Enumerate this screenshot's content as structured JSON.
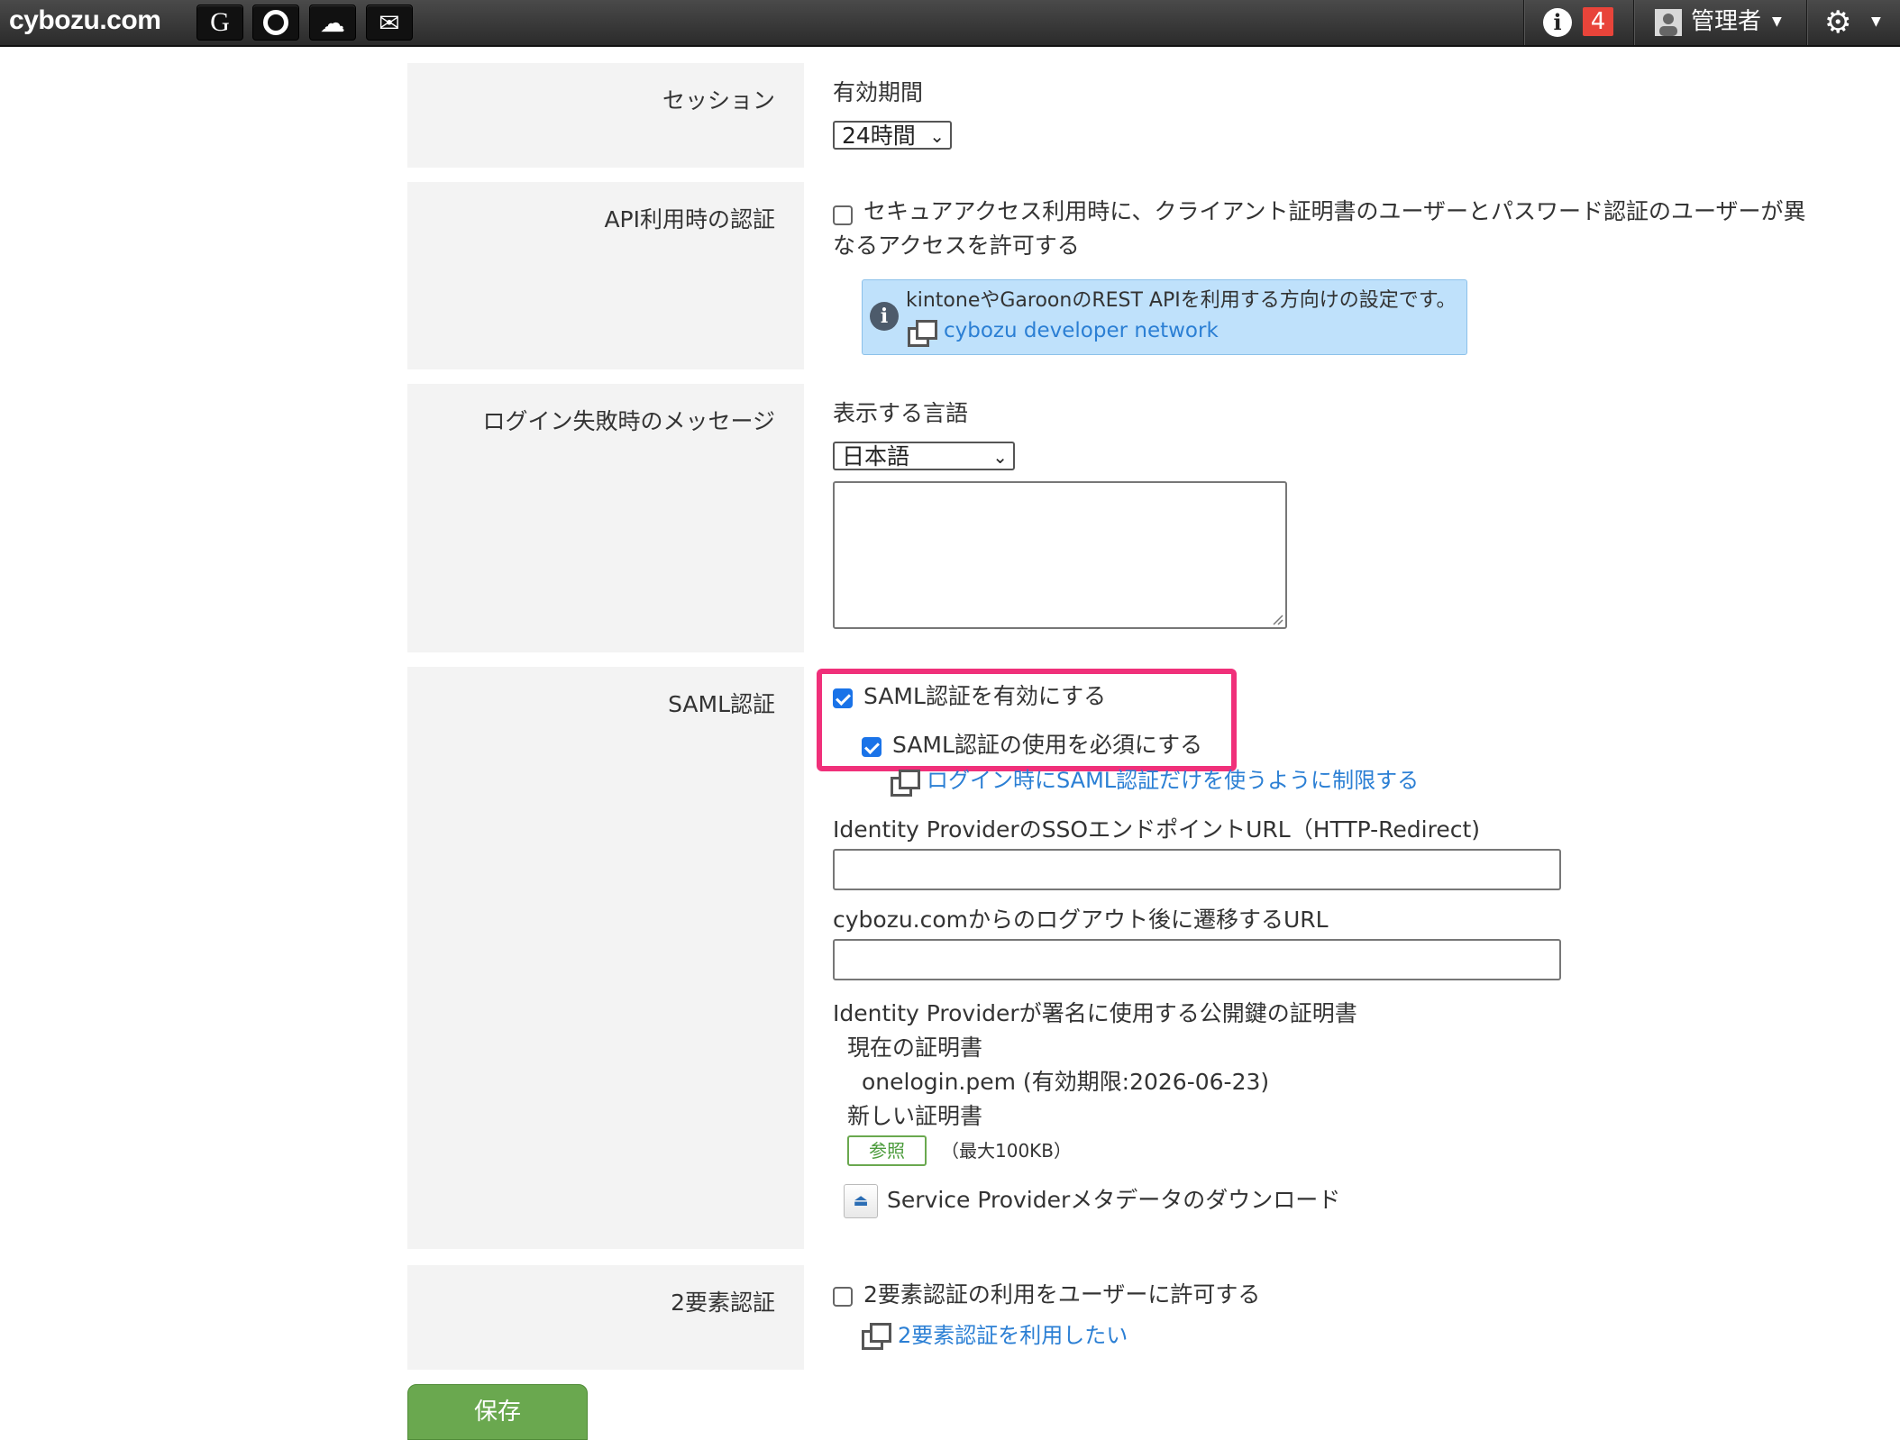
{
  "topbar": {
    "brand": "cybozu.com",
    "apps": [
      {
        "name": "garoon",
        "glyph": "G"
      },
      {
        "name": "office",
        "glyph": "O"
      },
      {
        "name": "mailwise",
        "glyph": "☁"
      },
      {
        "name": "mail",
        "glyph": "✉"
      }
    ],
    "notification_count": "4",
    "user_name": "管理者"
  },
  "session": {
    "label": "セッション",
    "period_label": "有効期間",
    "period_value": "24時間"
  },
  "api_auth": {
    "label": "API利用時の認証",
    "checkbox_text_line1": "セキュアアクセス利用時に、クライアント証明書のユーザーとパスワード認証のユーザーが異",
    "checkbox_text_line2": "なるアクセスを許可する",
    "checked": false,
    "info_text": "kintoneやGaroonのREST APIを利用する方向けの設定です。",
    "info_link": "cybozu developer network"
  },
  "login_fail": {
    "label": "ログイン失敗時のメッセージ",
    "language_label": "表示する言語",
    "language_value": "日本語",
    "message": ""
  },
  "saml": {
    "label": "SAML認証",
    "enable_text": "SAML認証を有効にする",
    "enable_checked": true,
    "require_text": "SAML認証の使用を必須にする",
    "require_checked": true,
    "restrict_link": "ログイン時にSAML認証だけを使うように制限する",
    "sso_url_label": "Identity ProviderのSSOエンドポイントURL（HTTP-Redirect)",
    "sso_url_value": "",
    "logout_url_label": "cybozu.comからのログアウト後に遷移するURL",
    "logout_url_value": "",
    "cert_label": "Identity Providerが署名に使用する公開鍵の証明書",
    "current_cert_label": "現在の証明書",
    "current_cert_value": "onelogin.pem (有効期限:2026-06-23)",
    "new_cert_label": "新しい証明書",
    "browse_label": "参照",
    "max_size": "（最大100KB）",
    "download_text": "Service Providerメタデータのダウンロード"
  },
  "two_factor": {
    "label": "2要素認証",
    "checkbox_text": "2要素認証の利用をユーザーに許可する",
    "checked": false,
    "link": "2要素認証を利用したい"
  },
  "save_label": "保存",
  "colors": {
    "highlight": "#f0307a",
    "save_button": "#6aa84f",
    "link": "#2b7fd4",
    "info_box": "#bfe1fb"
  }
}
